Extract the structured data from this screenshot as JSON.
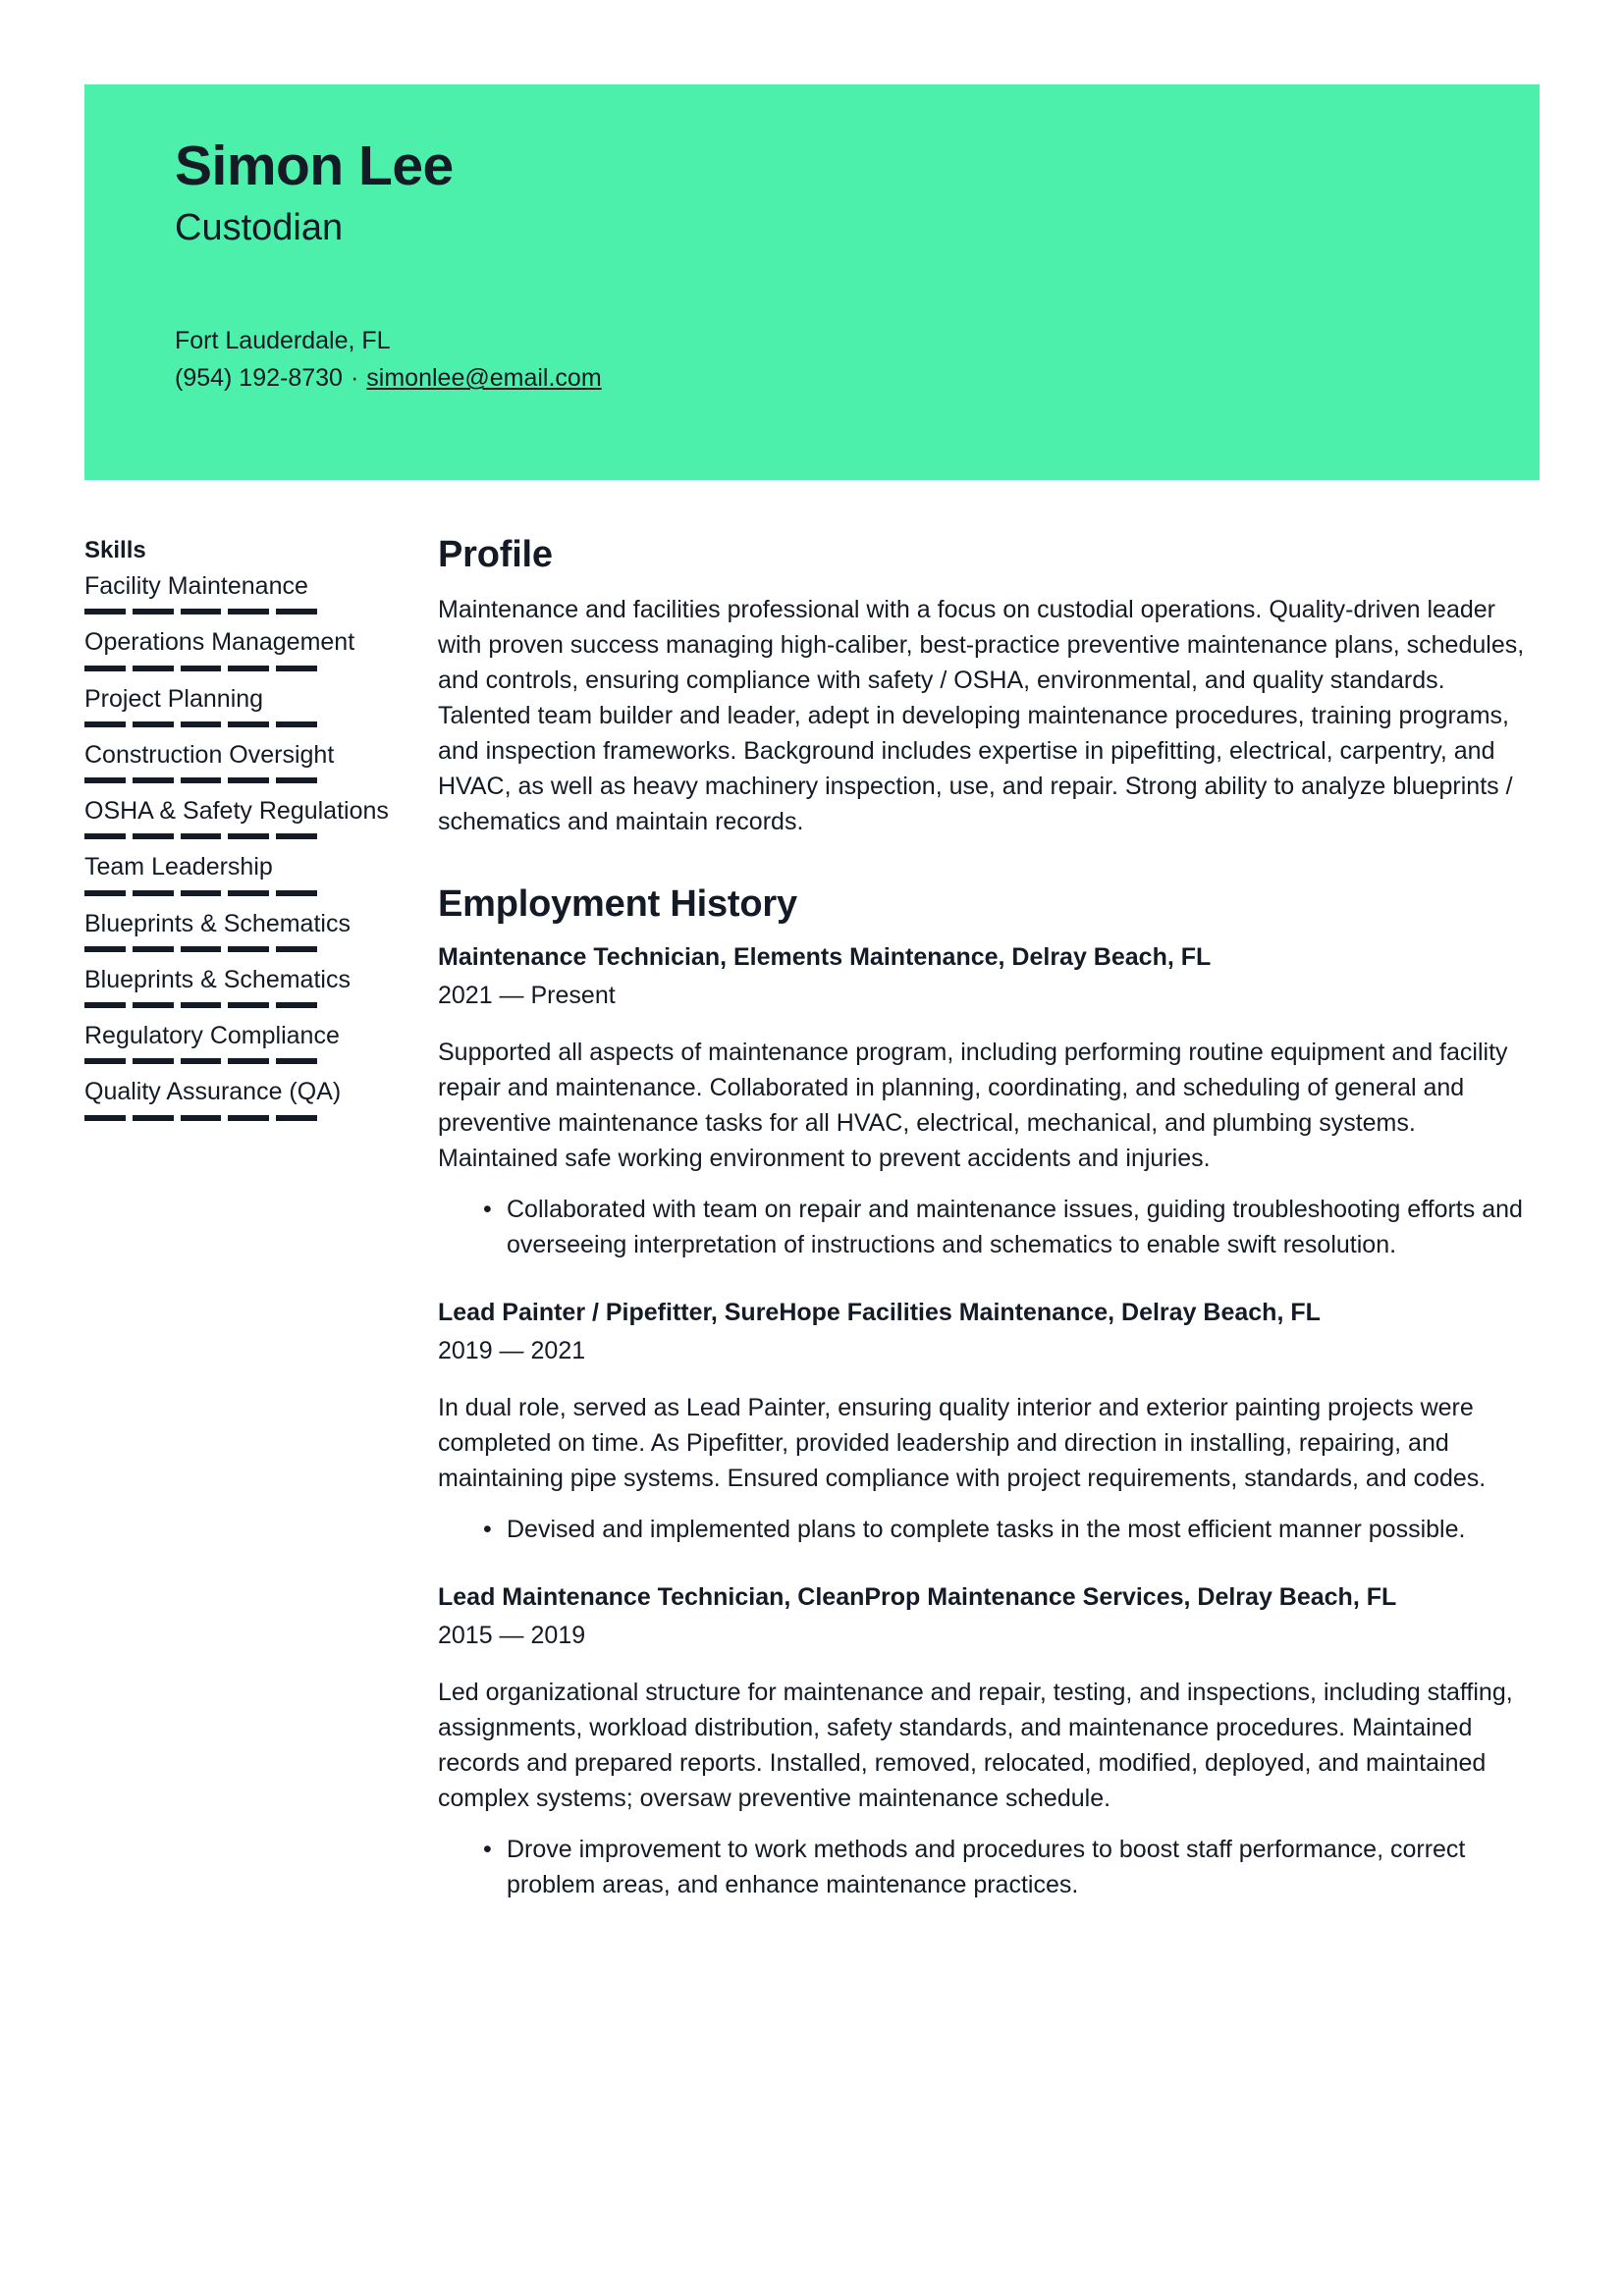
{
  "theme": {
    "banner_color": "#4cf0ab",
    "text_color": "#151b26",
    "rating_on_color": "#151b26",
    "rating_off_color": "#d9dde3"
  },
  "header": {
    "name": "Simon Lee",
    "job_title": "Custodian",
    "location": "Fort Lauderdale, FL",
    "phone": "(954) 192-8730",
    "separator": "·",
    "email": "simonlee@email.com"
  },
  "sidebar": {
    "skills_heading": "Skills",
    "skills": [
      {
        "label": "Facility Maintenance",
        "segments": 5,
        "filled": 5
      },
      {
        "label": "Operations Management",
        "segments": 5,
        "filled": 5
      },
      {
        "label": "Project Planning",
        "segments": 5,
        "filled": 5
      },
      {
        "label": "Construction Oversight",
        "segments": 5,
        "filled": 5
      },
      {
        "label": "OSHA & Safety Regulations",
        "segments": 5,
        "filled": 5
      },
      {
        "label": "Team Leadership",
        "segments": 5,
        "filled": 5
      },
      {
        "label": "Blueprints & Schematics",
        "segments": 5,
        "filled": 5
      },
      {
        "label": "Blueprints & Schematics",
        "segments": 5,
        "filled": 5
      },
      {
        "label": "Regulatory Compliance",
        "segments": 5,
        "filled": 5
      },
      {
        "label": "Quality Assurance (QA)",
        "segments": 5,
        "filled": 5
      }
    ]
  },
  "main": {
    "profile": {
      "heading": "Profile",
      "text": "Maintenance and facilities professional with a focus on custodial operations. Quality-driven leader with proven success managing high-caliber, best-practice preventive maintenance plans, schedules, and controls, ensuring compliance with safety / OSHA, environmental, and quality standards. Talented team builder and leader, adept in developing maintenance procedures, training programs, and inspection frameworks. Background includes expertise in pipefitting, electrical, carpentry, and HVAC, as well as heavy machinery inspection, use, and repair. Strong ability to analyze blueprints / schematics and maintain records."
    },
    "employment": {
      "heading": "Employment History",
      "jobs": [
        {
          "title": "Maintenance Technician,  Elements Maintenance, Delray Beach, FL",
          "dates": "2021 — Present",
          "description": "Supported all aspects of maintenance program, including performing routine equipment and facility repair and maintenance. Collaborated in planning, coordinating, and scheduling of general and preventive maintenance tasks for all HVAC, electrical, mechanical, and plumbing systems. Maintained safe working environment to prevent accidents and injuries.",
          "bullets": [
            "Collaborated with team on repair and maintenance issues, guiding troubleshooting efforts and overseeing interpretation of instructions and schematics to enable swift resolution."
          ]
        },
        {
          "title": "Lead Painter / Pipefitter, SureHope Facilities Maintenance,  Delray Beach, FL",
          "dates": "2019 — 2021",
          "description": "In dual role, served as Lead Painter, ensuring quality interior and exterior painting projects were completed on time. As Pipefitter, provided leadership and direction in installing, repairing, and maintaining pipe systems. Ensured compliance with project requirements, standards, and codes.",
          "bullets": [
            "Devised and implemented plans to complete tasks in the most efficient manner possible."
          ]
        },
        {
          "title": "Lead Maintenance Technician, CleanProp Maintenance Services, Delray Beach, FL",
          "dates": "2015 — 2019",
          "description": "Led organizational structure for maintenance and repair, testing, and inspections, including staffing, assignments, workload distribution, safety standards, and maintenance procedures. Maintained records and prepared reports. Installed, removed, relocated, modified, deployed, and maintained complex systems; oversaw preventive maintenance schedule.",
          "bullets": [
            "Drove improvement to work methods and procedures to boost staff performance, correct problem areas, and enhance maintenance practices."
          ]
        }
      ]
    }
  }
}
